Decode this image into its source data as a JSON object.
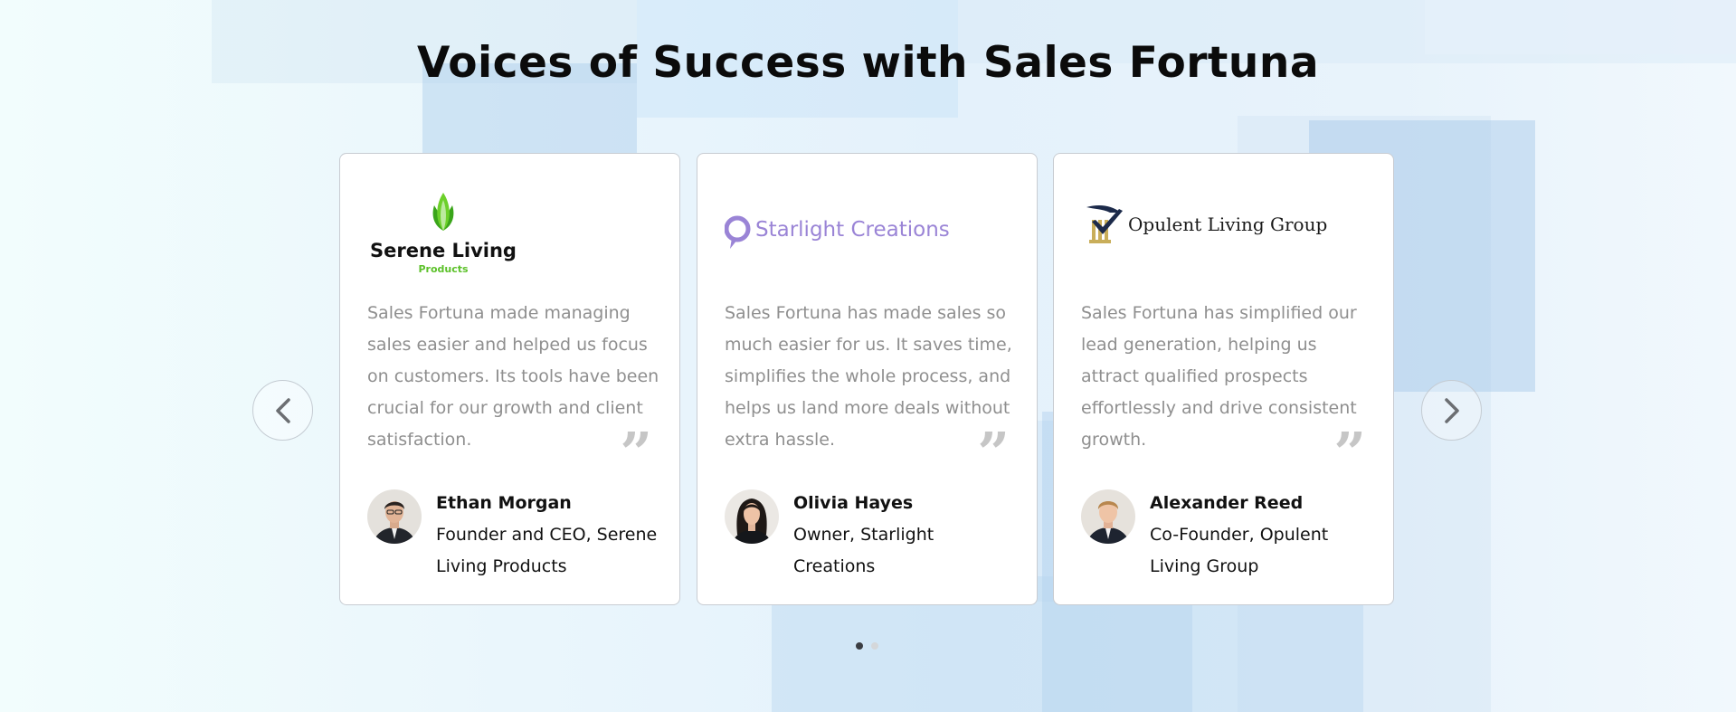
{
  "section": {
    "title": "Voices of Success with Sales Fortuna"
  },
  "colors": {
    "brand_green": "#5cc12a",
    "brand_purple": "#9a84d6",
    "brand_gold": "#c9ae5a",
    "brand_navy": "#1c2a4a",
    "quote_text": "#8f8f8f",
    "quote_mark": "#c6c6c6"
  },
  "testimonials": [
    {
      "logo": {
        "icon": "lotus-leaf-icon",
        "name": "Serene Living",
        "sub": "Products"
      },
      "quote": "Sales Fortuna made managing sales easier and helped us focus on customers. Its tools have been crucial for our growth and client satisfaction.",
      "quote_icon": "quote-mark-icon",
      "person": {
        "name": "Ethan Morgan",
        "role": "Founder and CEO, Serene Living Products"
      }
    },
    {
      "logo": {
        "icon": "speech-bubble-icon",
        "name": "Starlight Creations"
      },
      "quote": "Sales Fortuna has made sales so much easier for us. It saves time, simplifies the whole process, and helps us land more deals without extra hassle.",
      "quote_icon": "quote-mark-icon",
      "person": {
        "name": "Olivia Hayes",
        "role": "Owner, Starlight Creations"
      }
    },
    {
      "logo": {
        "icon": "pillar-check-icon",
        "name": "Opulent Living Group"
      },
      "quote": "Sales Fortuna has simplified our lead generation, helping us attract qualified prospects effortlessly and drive consistent growth.",
      "quote_icon": "quote-mark-icon",
      "person": {
        "name": "Alexander Reed",
        "role": "Co-Founder, Opulent Living Group"
      }
    }
  ],
  "carousel": {
    "prev_icon": "chevron-left-icon",
    "next_icon": "chevron-right-icon",
    "pages": 2,
    "active_page": 1
  }
}
